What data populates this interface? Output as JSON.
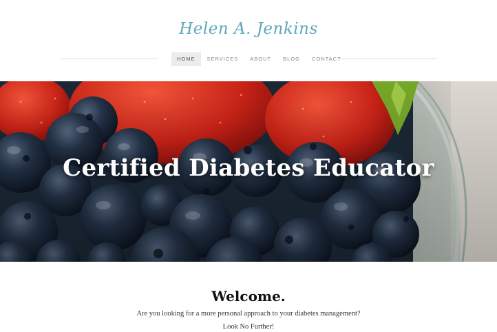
{
  "site": {
    "logo_text": "Helen A. Jenkins"
  },
  "nav": {
    "items": [
      {
        "label": "HOME",
        "active": true
      },
      {
        "label": "SERVICES",
        "active": false
      },
      {
        "label": "ABOUT",
        "active": false
      },
      {
        "label": "BLOG",
        "active": false
      },
      {
        "label": "CONTACT",
        "active": false
      }
    ]
  },
  "hero": {
    "title": "Certified Diabetes Educator",
    "image_description_icon": "berries-bowl-image"
  },
  "welcome": {
    "heading": "Welcome.",
    "line1": "Are you looking for a more personal approach to your diabetes management?",
    "line2": "Look No Further!"
  },
  "colors": {
    "logo": "#5aa9b8",
    "nav_active_bg": "#ececec",
    "nav_text": "#8a8a8a",
    "hero_text": "#ffffff",
    "heading_text": "#111111"
  }
}
